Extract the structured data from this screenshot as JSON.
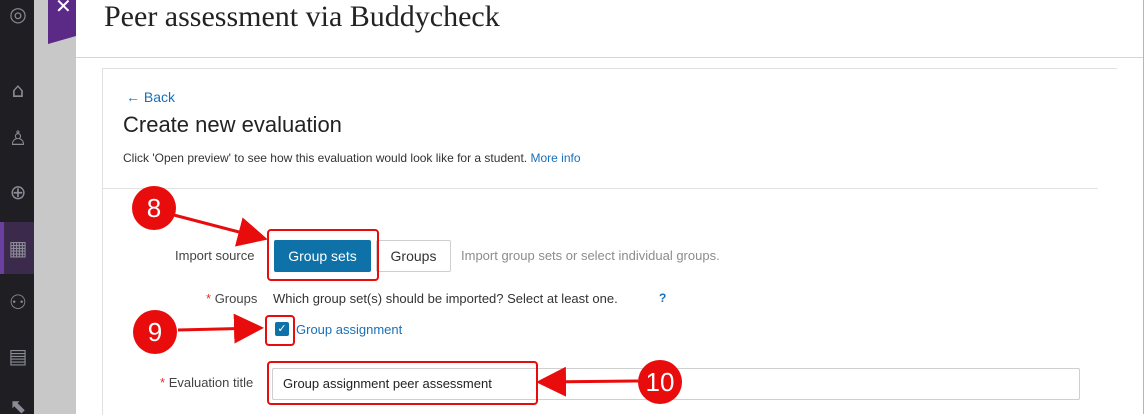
{
  "panel": {
    "title": "Peer assessment via Buddycheck",
    "close_icon": "x-icon"
  },
  "page": {
    "back_label": "← Back",
    "heading": "Create new evaluation",
    "hint_text": "Click 'Open preview' to see how this evaluation would look like for a student.",
    "hint_link": "More info"
  },
  "form": {
    "import_source": {
      "label": "Import source",
      "selected_option": "Group sets",
      "other_option": "Groups",
      "help_text": "Import group sets or select individual groups."
    },
    "groups": {
      "required_mark": "*",
      "label": "Groups",
      "instruction": "Which group set(s) should be imported? Select at least one.",
      "help_icon": "?",
      "checkbox_label": "Group assignment",
      "checked": true
    },
    "evaluation_title": {
      "required_mark": "*",
      "label": "Evaluation title",
      "value": "Group assignment peer assessment"
    }
  },
  "annotations": {
    "markers": [
      "8",
      "9",
      "10"
    ],
    "color": "#e80c0c"
  },
  "colors": {
    "primary": "#0e71a8",
    "link": "#1870b8",
    "nav_bg": "#1f1f23",
    "close_tab": "#5b2a86"
  },
  "left_nav_icons": [
    "globe-icon",
    "institution-icon",
    "person-icon",
    "globe-icon",
    "course-icon",
    "groups-icon",
    "calendar-icon",
    "arrow-icon"
  ]
}
